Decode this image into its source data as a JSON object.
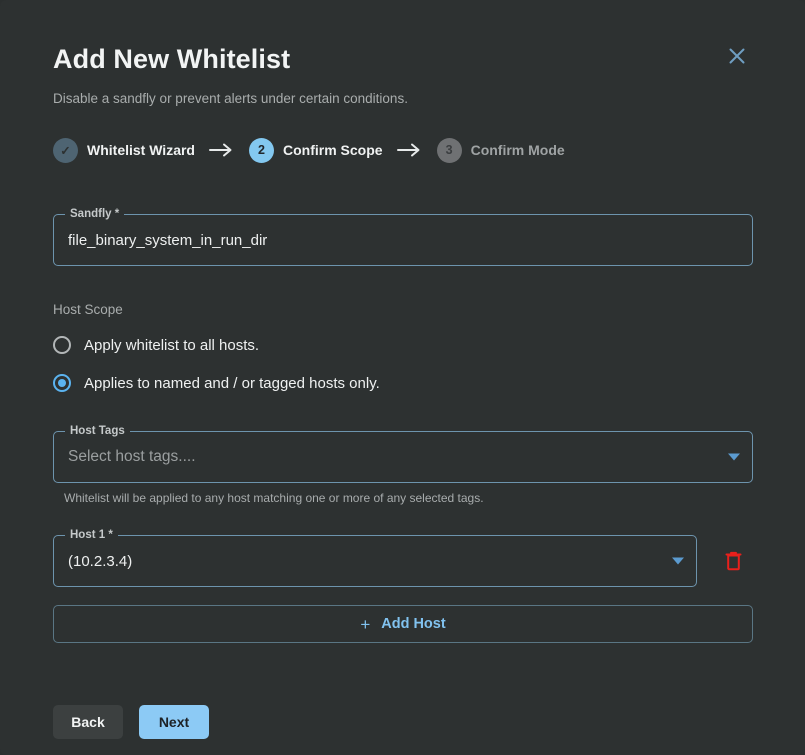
{
  "dialog": {
    "title": "Add New Whitelist",
    "subtitle": "Disable a sandfly or prevent alerts under certain conditions.",
    "close_icon": "close-icon"
  },
  "stepper": {
    "steps": [
      {
        "marker": "✓",
        "label": "Whitelist Wizard",
        "state": "done"
      },
      {
        "marker": "2",
        "label": "Confirm Scope",
        "state": "active"
      },
      {
        "marker": "3",
        "label": "Confirm Mode",
        "state": "todo"
      }
    ],
    "arrow": "→"
  },
  "sandfly_field": {
    "legend": "Sandfly *",
    "value": "file_binary_system_in_run_dir"
  },
  "host_scope": {
    "label": "Host Scope",
    "options": [
      {
        "label": "Apply whitelist to all hosts.",
        "checked": false
      },
      {
        "label": "Applies to named and / or tagged hosts only.",
        "checked": true
      }
    ]
  },
  "host_tags": {
    "legend": "Host Tags",
    "placeholder": "Select host tags....",
    "helper": "Whitelist will be applied to any host matching one or more of any selected tags."
  },
  "host_1": {
    "legend": "Host 1 *",
    "value": "(10.2.3.4)",
    "delete_icon": "trash-icon"
  },
  "add_host": {
    "label": "Add Host",
    "icon": "plus-icon"
  },
  "footer": {
    "back_label": "Back",
    "next_label": "Next"
  },
  "colors": {
    "background": "#2d3131",
    "accent_blue": "#8ccaf5",
    "field_border": "#6d94ad",
    "danger_red": "#e8201c",
    "step_done": "#4e6472",
    "step_todo": "#6f7173"
  }
}
